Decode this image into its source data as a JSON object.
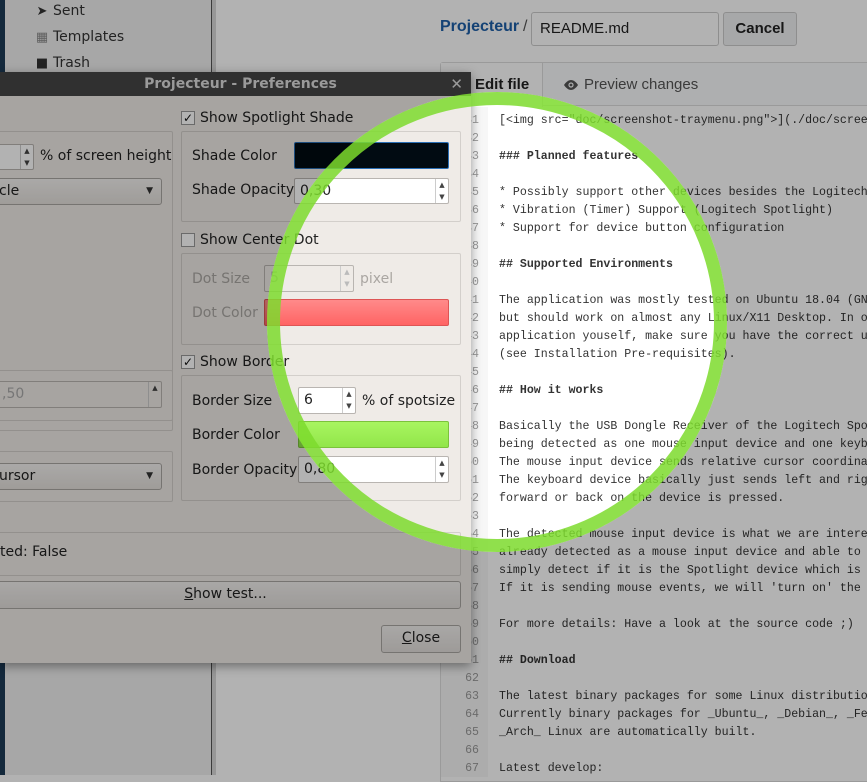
{
  "sidebar": {
    "items": [
      {
        "label": "Sent",
        "icon": "send-icon"
      },
      {
        "label": "Templates",
        "icon": "templates-icon"
      },
      {
        "label": "Trash",
        "icon": "trash-icon"
      }
    ]
  },
  "header": {
    "repo": "Projecteur",
    "separator": "/",
    "filename": "README.md",
    "cancel_label": "Cancel"
  },
  "tabs": [
    {
      "label": "Edit file",
      "active": true
    },
    {
      "label": "Preview changes",
      "icon": "eye-icon"
    }
  ],
  "editor": {
    "lines": [
      {
        "n": "31",
        "text": "[<img src=\"doc/screenshot-traymenu.png\">](./doc/scree"
      },
      {
        "n": "32",
        "text": ""
      },
      {
        "n": "33",
        "text": "### Planned features",
        "bold": true
      },
      {
        "n": "34",
        "text": ""
      },
      {
        "n": "35",
        "text": "* Possibly support other devices besides the Logitech"
      },
      {
        "n": "36",
        "text": "* Vibration (Timer) Support (Logitech Spotlight)"
      },
      {
        "n": "37",
        "text": "* Support for device button configuration"
      },
      {
        "n": "38",
        "text": ""
      },
      {
        "n": "39",
        "text": "## Supported Environments",
        "bold": true
      },
      {
        "n": "40",
        "text": ""
      },
      {
        "n": "41",
        "text": "The application was mostly tested on Ubuntu 18.04 (GN"
      },
      {
        "n": "42",
        "text": "but should work on almost any Linux/X11 Desktop. In o"
      },
      {
        "n": "43",
        "text": "application youself, make sure you have the correct u"
      },
      {
        "n": "44",
        "text": "(see Installation Pre-requisites)."
      },
      {
        "n": "45",
        "text": ""
      },
      {
        "n": "46",
        "text": "## How it works",
        "bold": true
      },
      {
        "n": "47",
        "text": ""
      },
      {
        "n": "48",
        "text": "Basically the USB Dongle Receiver of the Logitech Spo"
      },
      {
        "n": "49",
        "text": "being detected as one mouse input device and one keyb"
      },
      {
        "n": "50",
        "text": "The mouse input device sends relative cursor coordina"
      },
      {
        "n": "51",
        "text": "The keyboard device basically just sends left and rig"
      },
      {
        "n": "52",
        "text": "forward or back on the device is pressed."
      },
      {
        "n": "53",
        "text": ""
      },
      {
        "n": "54",
        "text": "The detected mouse input device is what we are intere"
      },
      {
        "n": "55",
        "text": "already detected as a mouse input device and able to"
      },
      {
        "n": "56",
        "text": "simply detect if it is the Spotlight device which is"
      },
      {
        "n": "57",
        "text": "If it is sending mouse events, we will 'turn on' the"
      },
      {
        "n": "58",
        "text": ""
      },
      {
        "n": "59",
        "text": "For more details: Have a look at the source code ;)"
      },
      {
        "n": "60",
        "text": ""
      },
      {
        "n": "61",
        "text": "## Download",
        "bold": true
      },
      {
        "n": "62",
        "text": ""
      },
      {
        "n": "63",
        "text": "The latest binary packages for some Linux distributio"
      },
      {
        "n": "64",
        "text": "Currently binary packages for _Ubuntu_, _Debian_, _Fe"
      },
      {
        "n": "65",
        "text": "_Arch_ Linux are automatically built."
      },
      {
        "n": "66",
        "text": ""
      },
      {
        "n": "67",
        "text": "Latest develop:"
      }
    ]
  },
  "dialog": {
    "title": "Projecteur - Preferences",
    "left": {
      "size_unit": "% of screen height",
      "shape_value": "cle",
      "disabled_value": ",50",
      "cursor_value": "ursor",
      "status": "ted: False"
    },
    "shade": {
      "checkbox": "Show Spotlight Shade",
      "checked": true,
      "color_label": "Shade Color",
      "color": "#010b12",
      "opacity_label": "Shade Opacity",
      "opacity": "0,30"
    },
    "dot": {
      "checkbox": "Show Center Dot",
      "checked": false,
      "size_label": "Dot Size",
      "size": "5",
      "size_unit": "pixel",
      "color_label": "Dot Color",
      "color": "#ff6b6b"
    },
    "border": {
      "checkbox": "Show Border",
      "checked": true,
      "size_label": "Border Size",
      "size": "6",
      "size_unit": "% of spotsize",
      "color_label": "Border Color",
      "color": "#9ff05a",
      "opacity_label": "Border Opacity",
      "opacity": "0,80"
    },
    "show_test_mnemonic": "S",
    "show_test_rest": "how test...",
    "close_mnemonic": "C",
    "close_rest": "lose"
  },
  "spotlight": {
    "ring_color": "#7dda2d",
    "shade_opacity": 0.3,
    "border_opacity": 0.8
  }
}
